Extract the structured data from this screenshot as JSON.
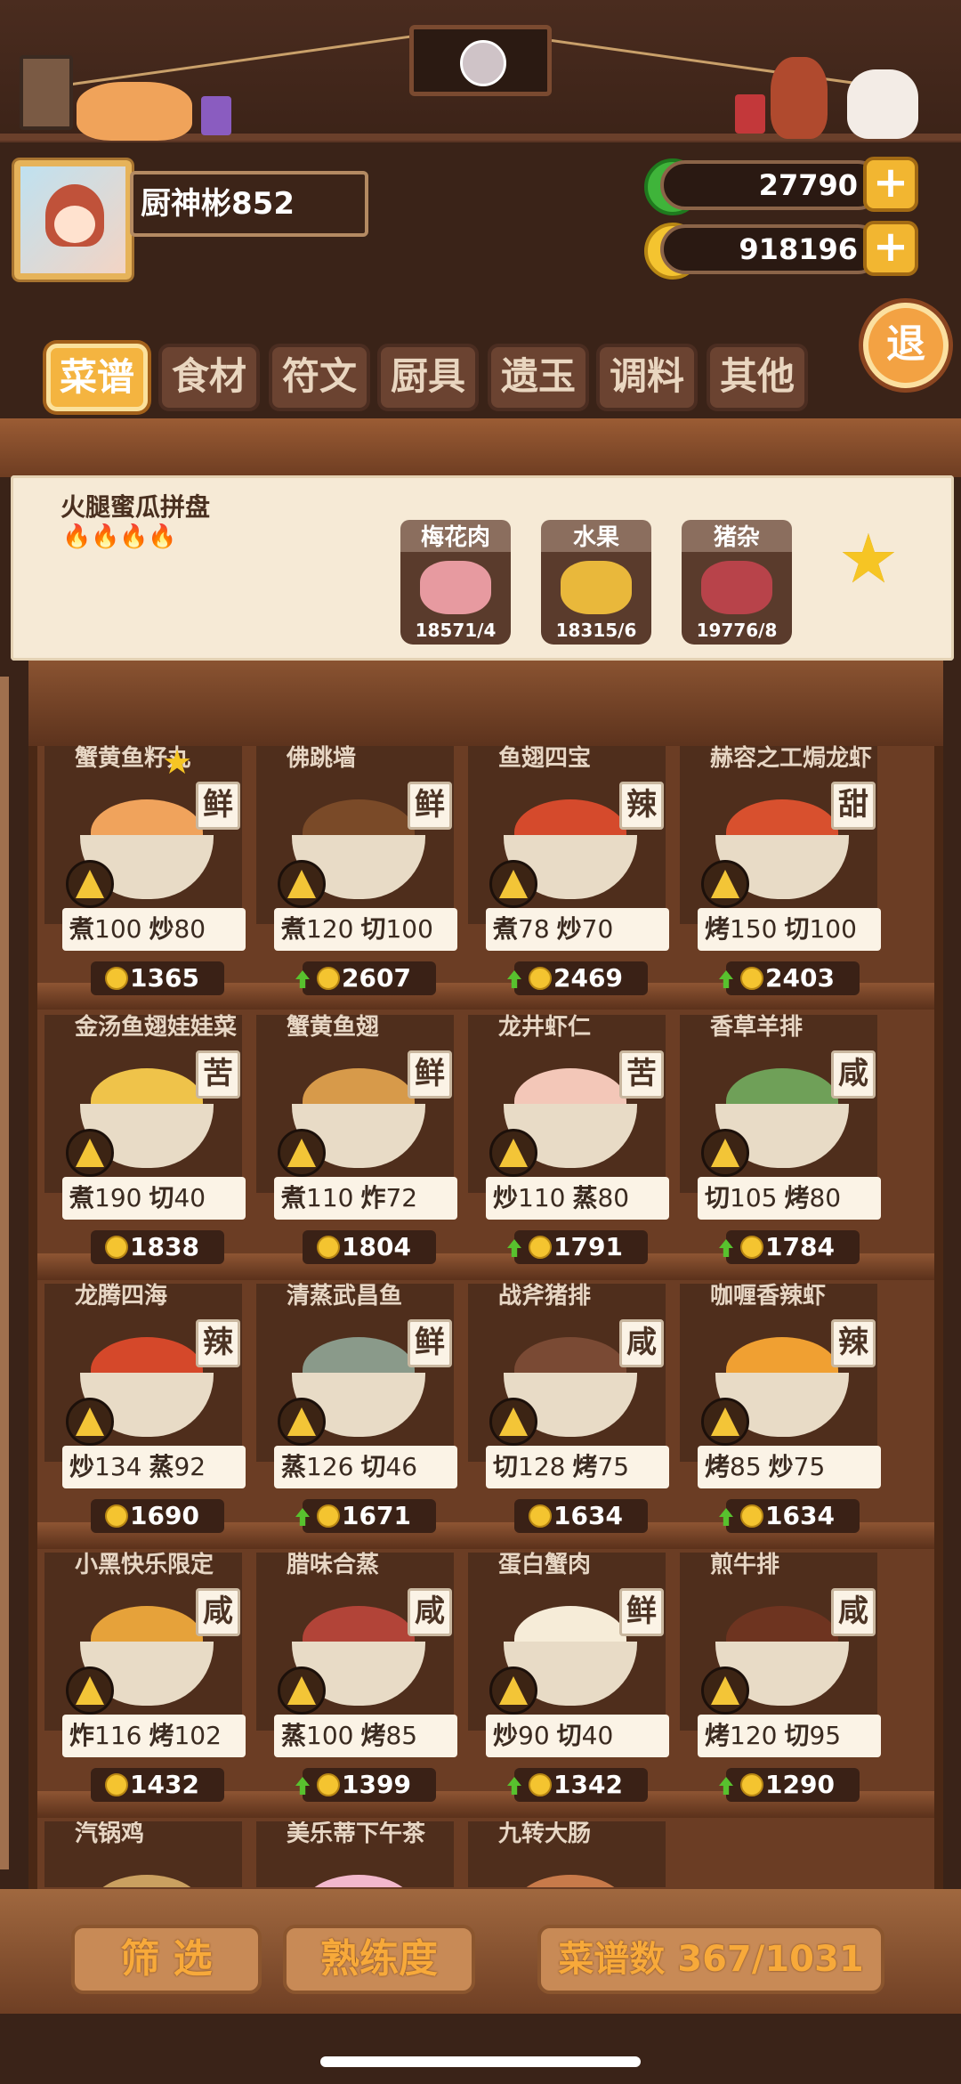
{
  "profile": {
    "name": "厨神彬852"
  },
  "currency": {
    "jade": "27790",
    "gold": "918196",
    "plus": "+"
  },
  "exit_label": "退",
  "tabs": [
    {
      "label": "菜谱",
      "active": true
    },
    {
      "label": "食材",
      "active": false
    },
    {
      "label": "符文",
      "active": false
    },
    {
      "label": "厨具",
      "active": false
    },
    {
      "label": "遗玉",
      "active": false
    },
    {
      "label": "调料",
      "active": false
    },
    {
      "label": "其他",
      "active": false
    }
  ],
  "detail": {
    "title": "火腿蜜瓜拼盘",
    "flames": 4,
    "ingredients": [
      {
        "name": "梅花肉",
        "count": "18571/4",
        "color": "#e79aa0"
      },
      {
        "name": "水果",
        "count": "18315/6",
        "color": "#e9b83b"
      },
      {
        "name": "猪杂",
        "count": "19776/8",
        "color": "#b8434a"
      }
    ],
    "flame_glyph": "🔥",
    "star_glyph": "★"
  },
  "recipes": [
    {
      "name": "蟹黄鱼籽丸",
      "taste": "鲜",
      "skills": [
        [
          "煮",
          "100"
        ],
        [
          "炒",
          "80"
        ]
      ],
      "price": "1365",
      "up": false,
      "food": "#f0a35c",
      "starred": true
    },
    {
      "name": "佛跳墙",
      "taste": "鲜",
      "skills": [
        [
          "煮",
          "120"
        ],
        [
          "切",
          "100"
        ]
      ],
      "price": "2607",
      "up": true,
      "food": "#7a4a28"
    },
    {
      "name": "鱼翅四宝",
      "taste": "辣",
      "skills": [
        [
          "煮",
          "78"
        ],
        [
          "炒",
          "70"
        ]
      ],
      "price": "2469",
      "up": true,
      "food": "#d54a2c"
    },
    {
      "name": "赫容之工焗龙虾",
      "taste": "甜",
      "skills": [
        [
          "烤",
          "150"
        ],
        [
          "切",
          "100"
        ]
      ],
      "price": "2403",
      "up": true,
      "food": "#d8502e"
    },
    {
      "name": "金汤鱼翅娃娃菜",
      "taste": "苦",
      "skills": [
        [
          "煮",
          "190"
        ],
        [
          "切",
          "40"
        ]
      ],
      "price": "1838",
      "up": false,
      "food": "#efc34a"
    },
    {
      "name": "蟹黄鱼翅",
      "taste": "鲜",
      "skills": [
        [
          "煮",
          "110"
        ],
        [
          "炸",
          "72"
        ]
      ],
      "price": "1804",
      "up": false,
      "food": "#d79a4a"
    },
    {
      "name": "龙井虾仁",
      "taste": "苦",
      "skills": [
        [
          "炒",
          "110"
        ],
        [
          "蒸",
          "80"
        ]
      ],
      "price": "1791",
      "up": true,
      "food": "#f3c7b8"
    },
    {
      "name": "香草羊排",
      "taste": "咸",
      "skills": [
        [
          "切",
          "105"
        ],
        [
          "烤",
          "80"
        ]
      ],
      "price": "1784",
      "up": true,
      "food": "#6fa058"
    },
    {
      "name": "龙腾四海",
      "taste": "辣",
      "skills": [
        [
          "炒",
          "134"
        ],
        [
          "蒸",
          "92"
        ]
      ],
      "price": "1690",
      "up": false,
      "food": "#d5482a"
    },
    {
      "name": "清蒸武昌鱼",
      "taste": "鲜",
      "skills": [
        [
          "蒸",
          "126"
        ],
        [
          "切",
          "46"
        ]
      ],
      "price": "1671",
      "up": true,
      "food": "#8a9a8a"
    },
    {
      "name": "战斧猪排",
      "taste": "咸",
      "skills": [
        [
          "切",
          "128"
        ],
        [
          "烤",
          "75"
        ]
      ],
      "price": "1634",
      "up": false,
      "food": "#7a4a34"
    },
    {
      "name": "咖喱香辣虾",
      "taste": "辣",
      "skills": [
        [
          "烤",
          "85"
        ],
        [
          "炒",
          "75"
        ]
      ],
      "price": "1634",
      "up": true,
      "food": "#f0a032"
    },
    {
      "name": "小黑快乐限定",
      "taste": "咸",
      "skills": [
        [
          "炸",
          "116"
        ],
        [
          "烤",
          "102"
        ]
      ],
      "price": "1432",
      "up": false,
      "food": "#e6a23a"
    },
    {
      "name": "腊味合蒸",
      "taste": "咸",
      "skills": [
        [
          "蒸",
          "100"
        ],
        [
          "烤",
          "85"
        ]
      ],
      "price": "1399",
      "up": true,
      "food": "#b24438"
    },
    {
      "name": "蛋白蟹肉",
      "taste": "鲜",
      "skills": [
        [
          "炒",
          "90"
        ],
        [
          "切",
          "40"
        ]
      ],
      "price": "1342",
      "up": true,
      "food": "#f6ecd8"
    },
    {
      "name": "煎牛排",
      "taste": "咸",
      "skills": [
        [
          "烤",
          "120"
        ],
        [
          "切",
          "95"
        ]
      ],
      "price": "1290",
      "up": true,
      "food": "#6e3420"
    },
    {
      "name": "汽锅鸡",
      "taste": "",
      "skills": [],
      "price": "",
      "up": false,
      "food": "#caa060"
    },
    {
      "name": "美乐蒂下午茶",
      "taste": "",
      "skills": [],
      "price": "",
      "up": false,
      "food": "#f2b8cc"
    },
    {
      "name": "九转大肠",
      "taste": "",
      "skills": [],
      "price": "",
      "up": false,
      "food": "#c87a4a"
    }
  ],
  "bottom": {
    "filter": "筛 选",
    "mastery": "熟练度",
    "count": "菜谱数 367/1031"
  }
}
